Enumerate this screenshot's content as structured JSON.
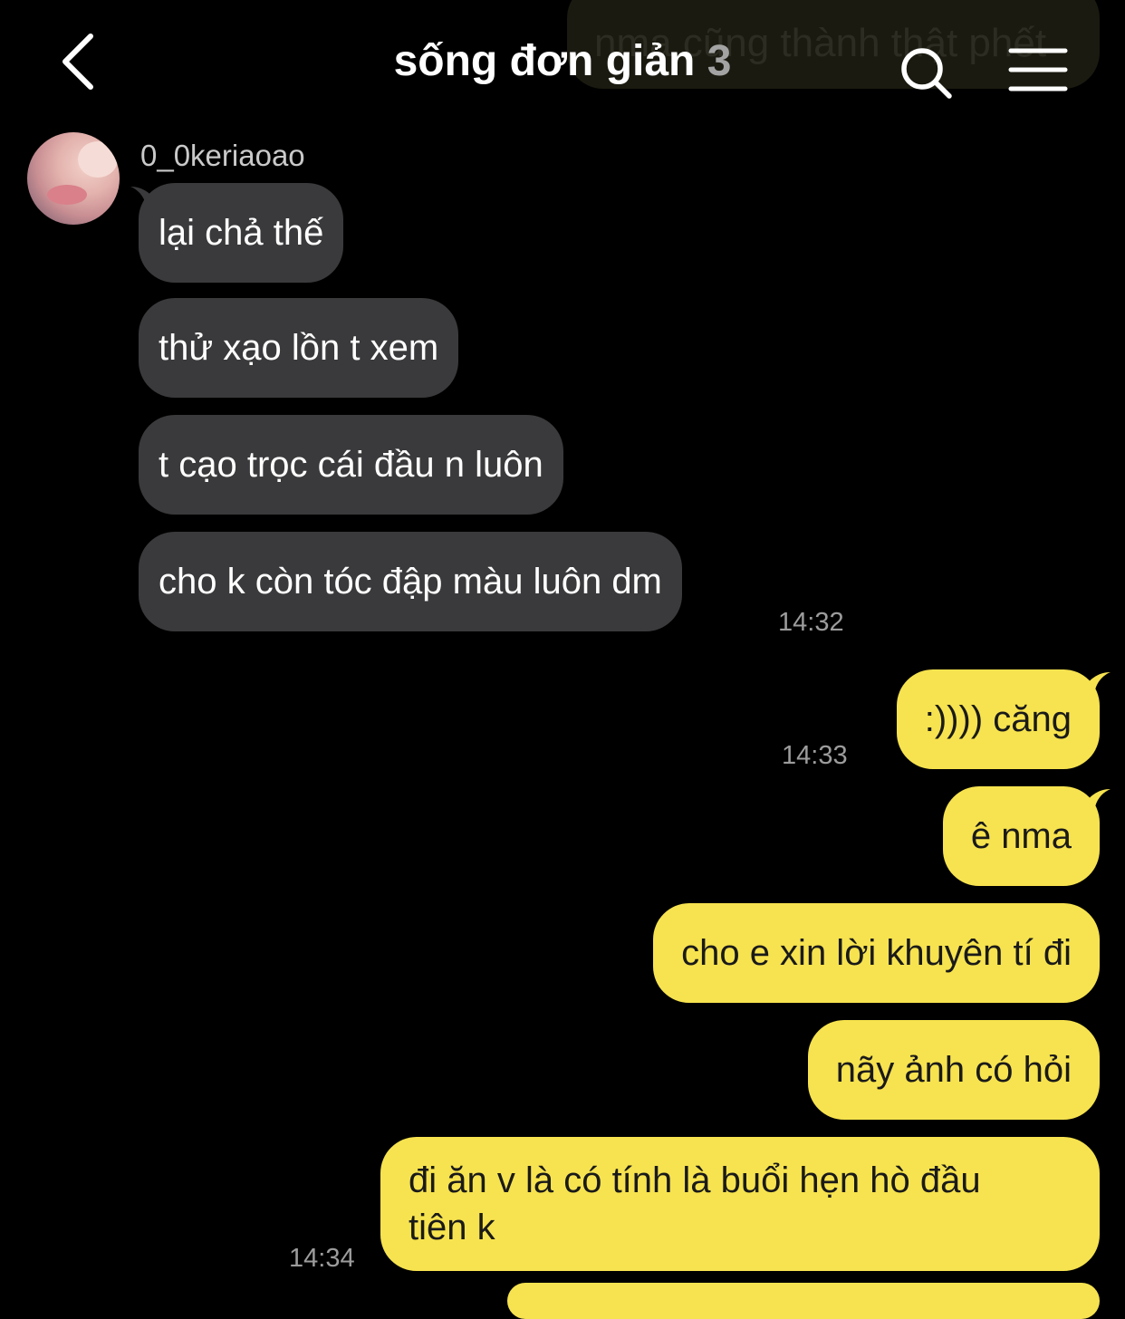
{
  "header": {
    "back_icon": "chevron-left-icon",
    "title": "sống đơn giản",
    "member_count": "3",
    "search_icon": "search-icon",
    "menu_icon": "hamburger-menu-icon"
  },
  "background_bubble": {
    "text": "nma cũng thành thật phết"
  },
  "conversation": {
    "sender_name": "0_0keriaoao",
    "incoming": [
      "lại chả thế",
      "thử xạo lồn t xem",
      "t cạo trọc cái đầu n luôn",
      "cho k còn tóc đập màu luôn dm"
    ],
    "incoming_time": "14:32",
    "outgoing_group_1": [
      ":)))) căng"
    ],
    "outgoing_time_1": "14:33",
    "outgoing_group_2": [
      "ê nma",
      "cho e xin lời khuyên tí đi",
      "nãy ảnh có hỏi"
    ],
    "outgoing_last_line1": "đi ăn v là có tính là buổi hẹn hò đầu",
    "outgoing_last_line2": "tiên k",
    "outgoing_time_2": "14:34"
  },
  "colors": {
    "background": "#000000",
    "incoming_bubble": "#3a3a3c",
    "outgoing_bubble": "#f7e34f",
    "timestamp": "#9c9c9c"
  }
}
